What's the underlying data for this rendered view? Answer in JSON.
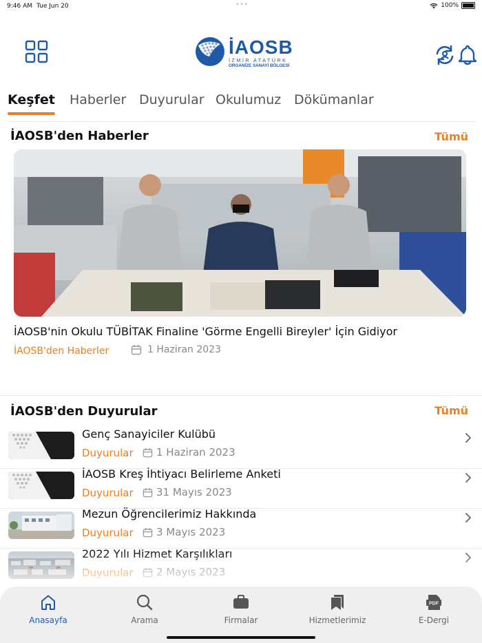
{
  "status_bar": {
    "time": "9:46 AM",
    "date": "Tue Jun 20",
    "battery": "100%"
  },
  "header": {
    "logo_text": "İAOSB",
    "logo_sub1": "İZMİR ATATÜRK",
    "logo_sub2": "ORGANİZE SANAYİ BÖLGESİ",
    "icons": [
      "grid-icon",
      "refresh-icon",
      "bell-icon"
    ]
  },
  "tabs": [
    {
      "label": "Keşfet",
      "active": true
    },
    {
      "label": "Haberler",
      "active": false
    },
    {
      "label": "Duyurular",
      "active": false
    },
    {
      "label": "Okulumuz",
      "active": false
    },
    {
      "label": "Dökümanlar",
      "active": false
    }
  ],
  "news_section": {
    "title": "İAOSB'den Haberler",
    "see_all": "Tümü",
    "item": {
      "title": "İAOSB'nin Okulu TÜBİTAK Finaline 'Görme Engelli Bireyler' İçin Gidiyor",
      "category": "İAOSB'den Haberler",
      "date": "1 Haziran 2023"
    }
  },
  "announcements_section": {
    "title": "İAOSB'den Duyurular",
    "see_all": "Tümü",
    "items": [
      {
        "title": "Genç Sanayiciler Kulübü",
        "category": "Duyurular",
        "date": "1 Haziran 2023"
      },
      {
        "title": "İAOSB Kreş İhtiyacı Belirleme Anketi",
        "category": "Duyurular",
        "date": "31 Mayıs 2023"
      },
      {
        "title": "Mezun Öğrencilerimiz Hakkında",
        "category": "Duyurular",
        "date": "3 Mayıs 2023"
      },
      {
        "title": "2022 Yılı Hizmet Karşılıkları",
        "category": "Duyurular",
        "date": "2 Mayıs 2023"
      }
    ]
  },
  "tab_bar": {
    "items": [
      {
        "label": "Anasayfa",
        "icon": "home-icon",
        "active": true
      },
      {
        "label": "Arama",
        "icon": "search-icon",
        "active": false
      },
      {
        "label": "Firmalar",
        "icon": "briefcase-icon",
        "active": false
      },
      {
        "label": "Hizmetlerimiz",
        "icon": "bookmarks-icon",
        "active": false
      },
      {
        "label": "E-Dergi",
        "icon": "pdf-icon",
        "active": false
      }
    ]
  },
  "colors": {
    "accent": "#f07d1e",
    "brand": "#1e5aa8",
    "text": "#111111",
    "muted": "#888888"
  }
}
